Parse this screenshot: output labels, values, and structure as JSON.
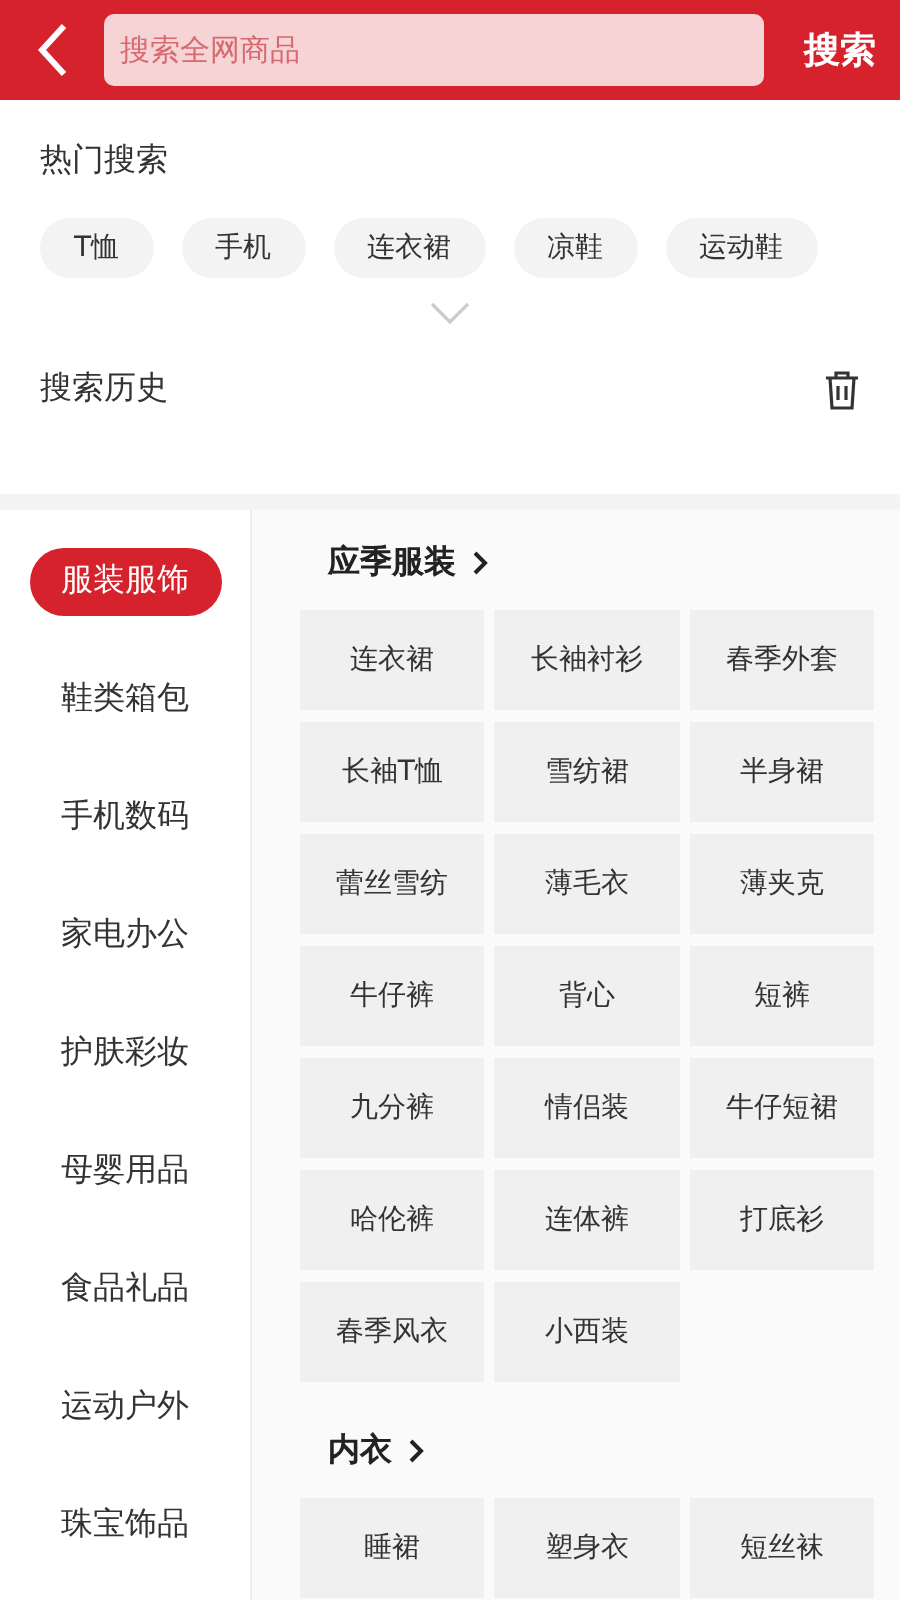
{
  "header": {
    "search": {
      "placeholder": "搜索全网商品"
    },
    "search_button": "搜索"
  },
  "hot_search": {
    "title": "热门搜索",
    "tags": [
      "T恤",
      "手机",
      "连衣裙",
      "凉鞋",
      "运动鞋"
    ]
  },
  "history": {
    "title": "搜索历史"
  },
  "categories": [
    {
      "label": "服装服饰",
      "selected": true
    },
    {
      "label": "鞋类箱包",
      "selected": false
    },
    {
      "label": "手机数码",
      "selected": false
    },
    {
      "label": "家电办公",
      "selected": false
    },
    {
      "label": "护肤彩妆",
      "selected": false
    },
    {
      "label": "母婴用品",
      "selected": false
    },
    {
      "label": "食品礼品",
      "selected": false
    },
    {
      "label": "运动户外",
      "selected": false
    },
    {
      "label": "珠宝饰品",
      "selected": false
    }
  ],
  "sections": [
    {
      "title": "应季服装",
      "items": [
        "连衣裙",
        "长袖衬衫",
        "春季外套",
        "长袖T恤",
        "雪纺裙",
        "半身裙",
        "蕾丝雪纺",
        "薄毛衣",
        "薄夹克",
        "牛仔裤",
        "背心",
        "短裤",
        "九分裤",
        "情侣装",
        "牛仔短裙",
        "哈伦裤",
        "连体裤",
        "打底衫",
        "春季风衣",
        "小西装"
      ]
    },
    {
      "title": "内衣",
      "items": [
        "睡裙",
        "塑身衣",
        "短丝袜"
      ]
    }
  ]
}
